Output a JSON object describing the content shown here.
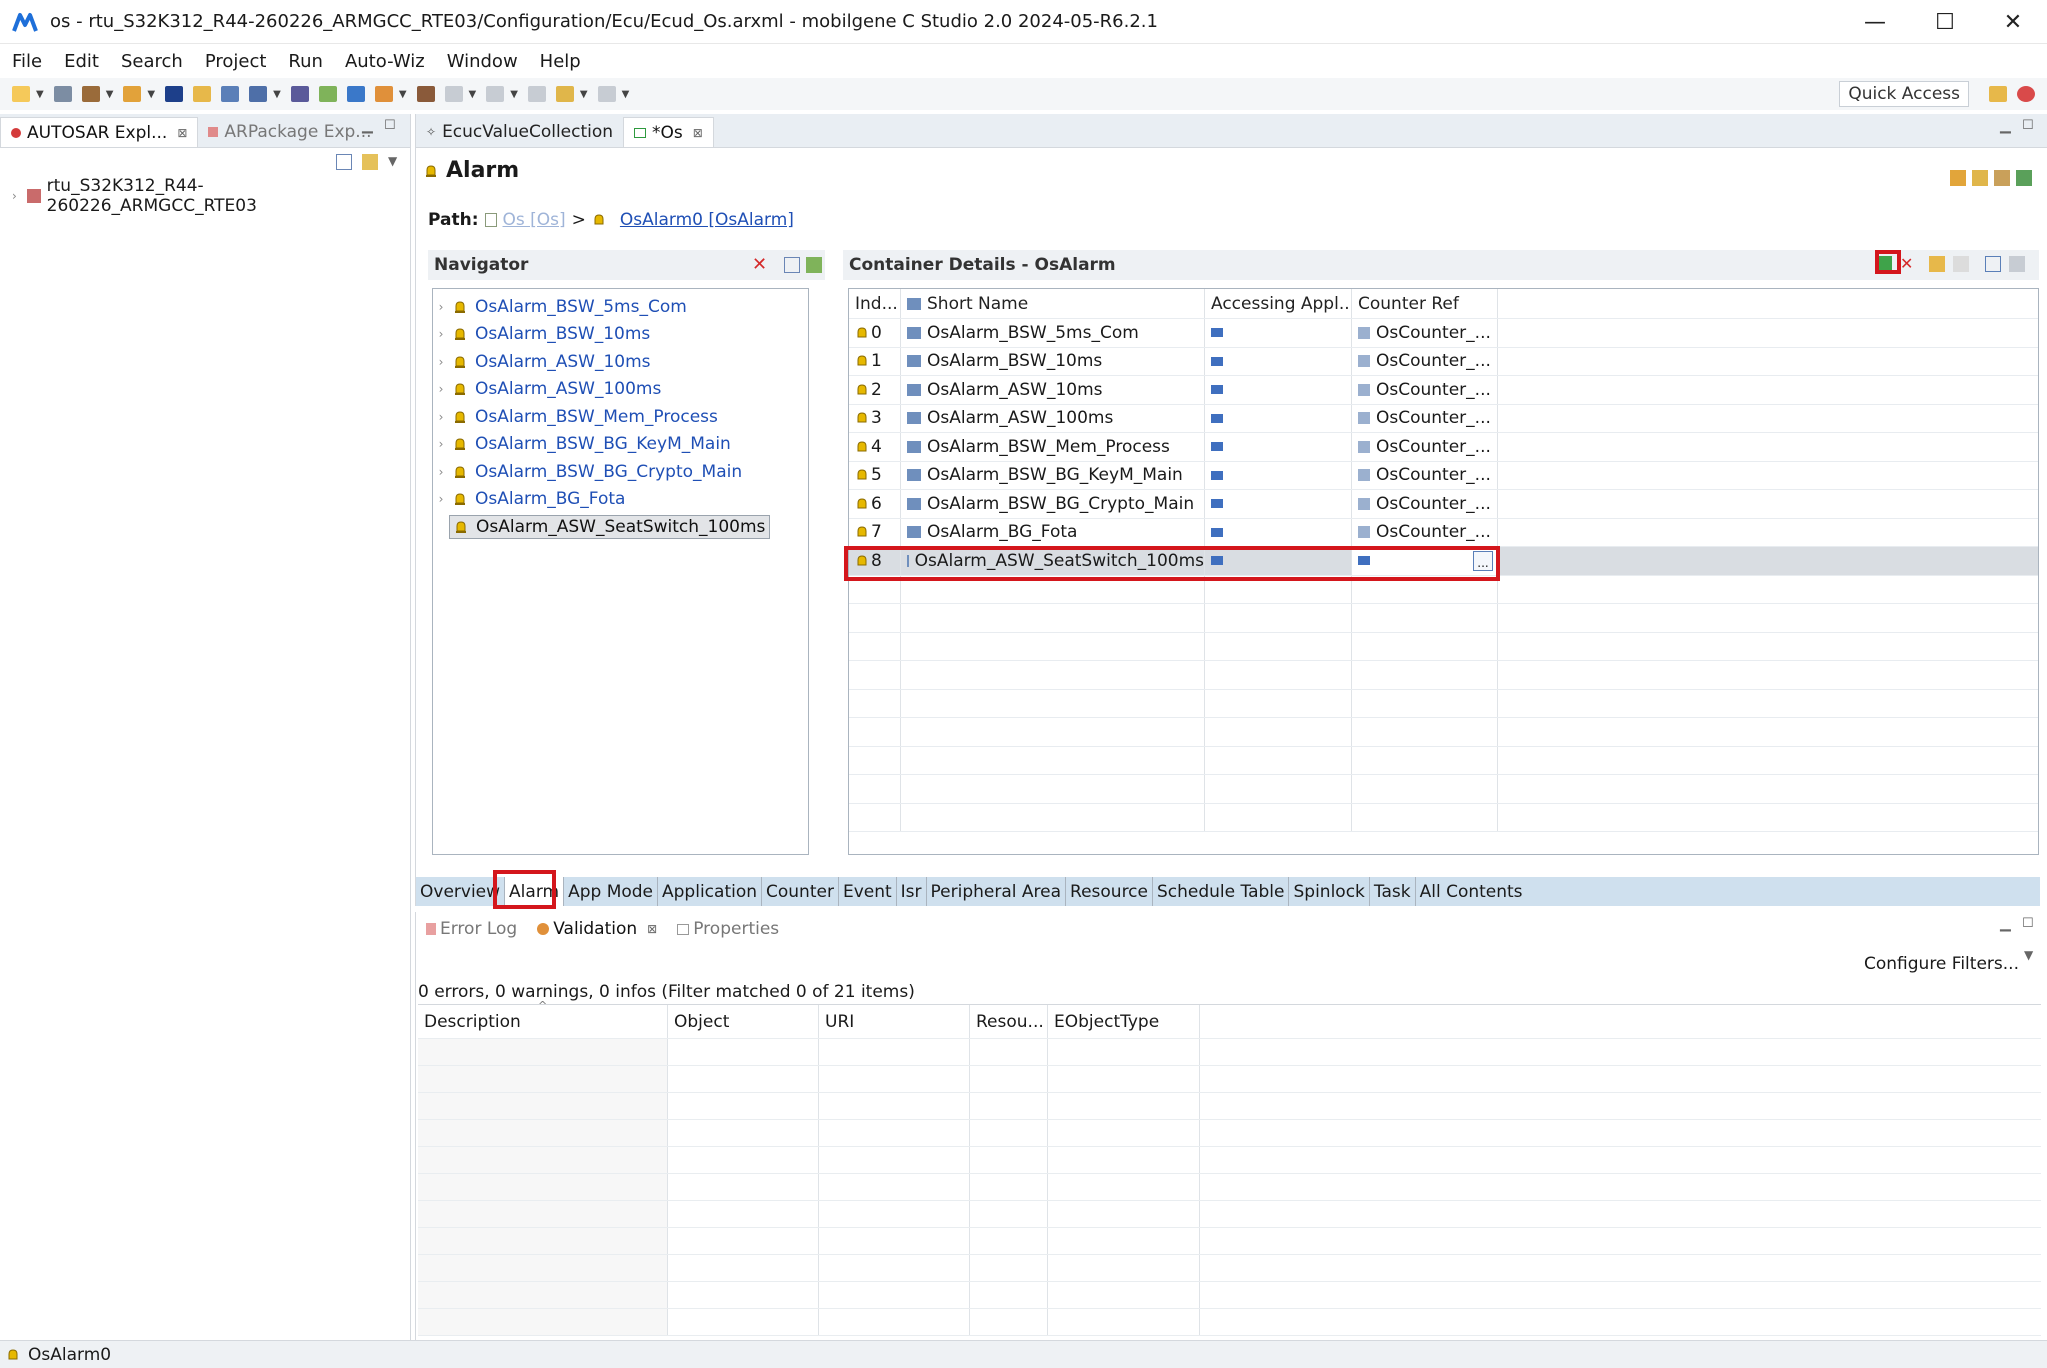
{
  "window": {
    "title": "os - rtu_S32K312_R44-260226_ARMGCC_RTE03/Configuration/Ecu/Ecud_Os.arxml - mobilgene C Studio 2.0 2024-05-R6.2.1",
    "minimize": "—",
    "maximize": "☐",
    "close": "✕"
  },
  "menu": [
    "File",
    "Edit",
    "Search",
    "Project",
    "Run",
    "Auto-Wiz",
    "Window",
    "Help"
  ],
  "toolbar": {
    "quick_access": "Quick Access"
  },
  "left_panel": {
    "tabs": [
      {
        "label": "AUTOSAR Expl...",
        "close": "⊠"
      },
      {
        "label": "ARPackage Exp..."
      }
    ],
    "tree_root": "rtu_S32K312_R44-260226_ARMGCC_RTE03"
  },
  "editor": {
    "tabs": [
      {
        "label": "EcucValueCollection"
      },
      {
        "label": "*Os",
        "close": "⊠"
      }
    ],
    "section_title": "Alarm",
    "path": {
      "label": "Path:",
      "parent": "Os [Os]",
      "separator": ">",
      "current": "OsAlarm0 [OsAlarm]"
    },
    "navigator": {
      "title": "Navigator",
      "items": [
        "OsAlarm_BSW_5ms_Com",
        "OsAlarm_BSW_10ms",
        "OsAlarm_ASW_10ms",
        "OsAlarm_ASW_100ms",
        "OsAlarm_BSW_Mem_Process",
        "OsAlarm_BSW_BG_KeyM_Main",
        "OsAlarm_BSW_BG_Crypto_Main",
        "OsAlarm_BG_Fota",
        "OsAlarm_ASW_SeatSwitch_100ms"
      ]
    },
    "details": {
      "title": "Container Details - OsAlarm",
      "columns": [
        "Ind...",
        "Short Name",
        "Accessing Appl...",
        "Counter Ref"
      ],
      "rows": [
        {
          "index": "0",
          "name": "OsAlarm_BSW_5ms_Com",
          "counter": "OsCounter_..."
        },
        {
          "index": "1",
          "name": "OsAlarm_BSW_10ms",
          "counter": "OsCounter_..."
        },
        {
          "index": "2",
          "name": "OsAlarm_ASW_10ms",
          "counter": "OsCounter_..."
        },
        {
          "index": "3",
          "name": "OsAlarm_ASW_100ms",
          "counter": "OsCounter_..."
        },
        {
          "index": "4",
          "name": "OsAlarm_BSW_Mem_Process",
          "counter": "OsCounter_..."
        },
        {
          "index": "5",
          "name": "OsAlarm_BSW_BG_KeyM_Main",
          "counter": "OsCounter_..."
        },
        {
          "index": "6",
          "name": "OsAlarm_BSW_BG_Crypto_Main",
          "counter": "OsCounter_..."
        },
        {
          "index": "7",
          "name": "OsAlarm_BG_Fota",
          "counter": "OsCounter_..."
        },
        {
          "index": "8",
          "name": "OsAlarm_ASW_SeatSwitch_100ms",
          "counter": ""
        }
      ],
      "browse_button": "..."
    },
    "page_tabs": [
      "Overview",
      "Alarm",
      "App Mode",
      "Application",
      "Counter",
      "Event",
      "Isr",
      "Peripheral Area",
      "Resource",
      "Schedule Table",
      "Spinlock",
      "Task",
      "All Contents"
    ]
  },
  "lower_panel": {
    "tabs": [
      {
        "label": "Error Log"
      },
      {
        "label": "Validation",
        "close": "⊠"
      },
      {
        "label": "Properties"
      }
    ],
    "configure_filters": "Configure Filters...",
    "summary": "0 errors, 0 warnings, 0 infos (Filter matched 0 of 21 items)",
    "columns": [
      "Description",
      "Object",
      "URI",
      "Resou...",
      "EObjectType"
    ]
  },
  "status": {
    "text": "OsAlarm0"
  },
  "colors": {
    "accent_red": "#d4161c",
    "link": "#1f4fb5",
    "tab_strip": "#cfe0ee"
  }
}
